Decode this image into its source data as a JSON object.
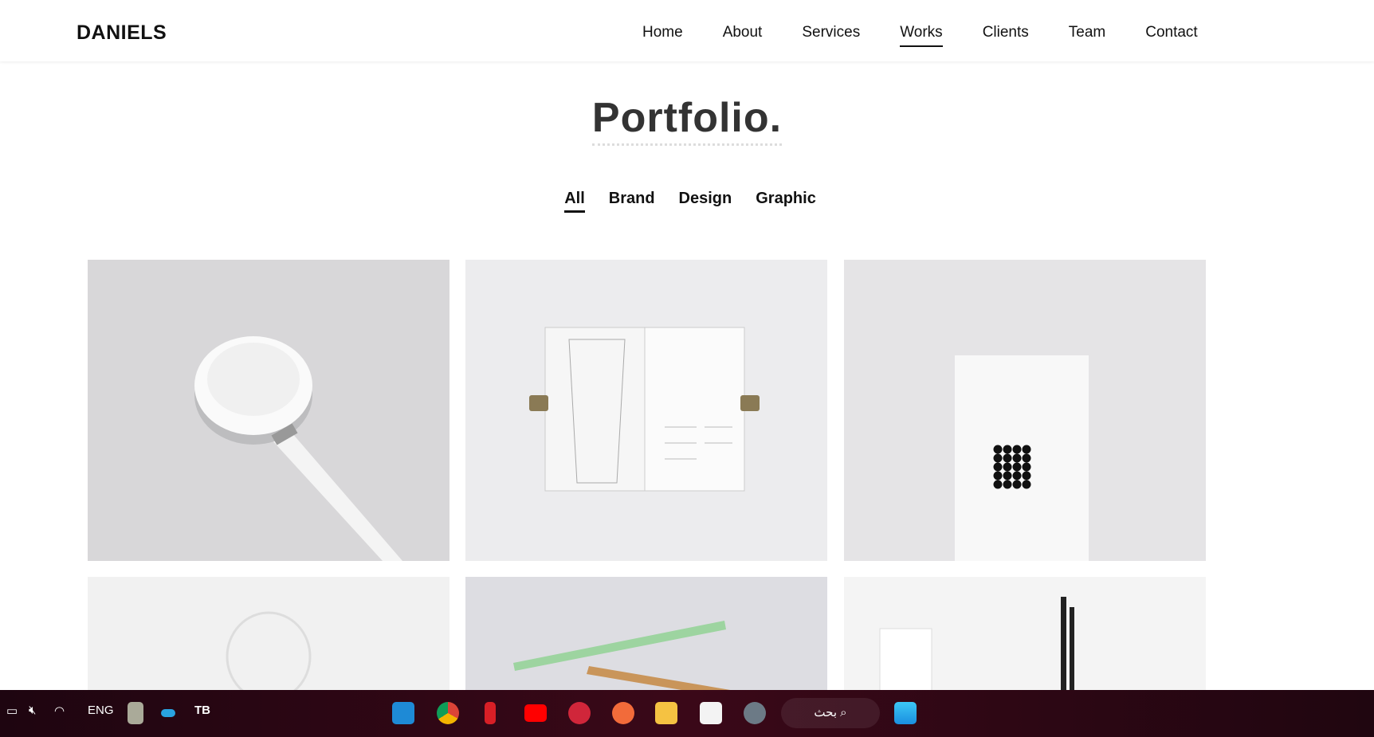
{
  "nav": {
    "logo": "DANIELS",
    "items": [
      {
        "label": "Home"
      },
      {
        "label": "About"
      },
      {
        "label": "Services"
      },
      {
        "label": "Works",
        "active": true
      },
      {
        "label": "Clients"
      },
      {
        "label": "Team"
      },
      {
        "label": "Contact"
      }
    ]
  },
  "page": {
    "title": "Portfolio."
  },
  "filters": [
    {
      "label": "All",
      "active": true
    },
    {
      "label": "Brand"
    },
    {
      "label": "Design"
    },
    {
      "label": "Graphic"
    }
  ],
  "portfolio": [
    {
      "image": "apple-watch-charger"
    },
    {
      "image": "open-map-booklet"
    },
    {
      "image": "white-card-dots"
    },
    {
      "image": "light-bulb"
    },
    {
      "image": "rulers"
    },
    {
      "image": "pens-and-card"
    }
  ],
  "taskbar": {
    "language": "ENG",
    "search_label": "بحث",
    "apps": [
      "vscode",
      "chrome",
      "netflix",
      "youtube",
      "pinterest",
      "brush-app",
      "file-explorer",
      "microsoft-store",
      "settings",
      "windows-start"
    ]
  }
}
